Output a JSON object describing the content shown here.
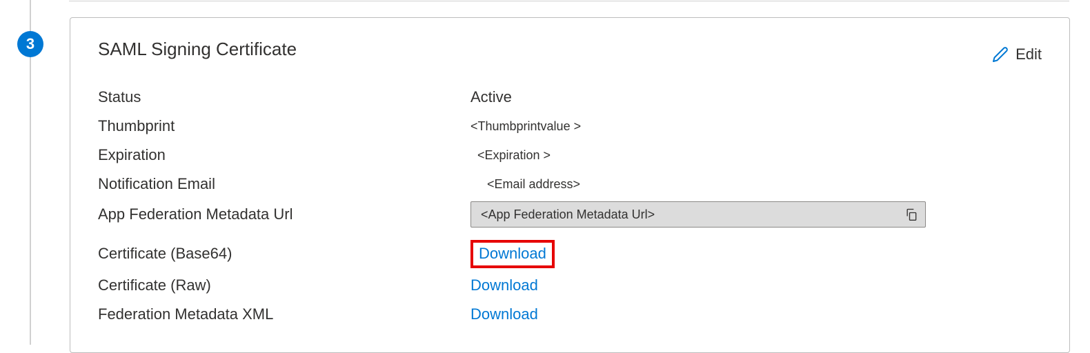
{
  "step": {
    "number": "3"
  },
  "panel": {
    "title": "SAML Signing Certificate",
    "edit_label": "Edit"
  },
  "fields": {
    "status": {
      "label": "Status",
      "value": "Active"
    },
    "thumbprint": {
      "label": "Thumbprint",
      "value": "<Thumbprintvalue >"
    },
    "expiration": {
      "label": "Expiration",
      "value": "<Expiration >"
    },
    "notification_email": {
      "label": "Notification Email",
      "value": "<Email address>"
    },
    "metadata_url": {
      "label": "App Federation Metadata Url",
      "value": "<App Federation Metadata Url>"
    },
    "cert_base64": {
      "label": "Certificate (Base64)",
      "action": "Download"
    },
    "cert_raw": {
      "label": "Certificate (Raw)",
      "action": "Download"
    },
    "fed_xml": {
      "label": "Federation Metadata XML",
      "action": "Download"
    }
  }
}
